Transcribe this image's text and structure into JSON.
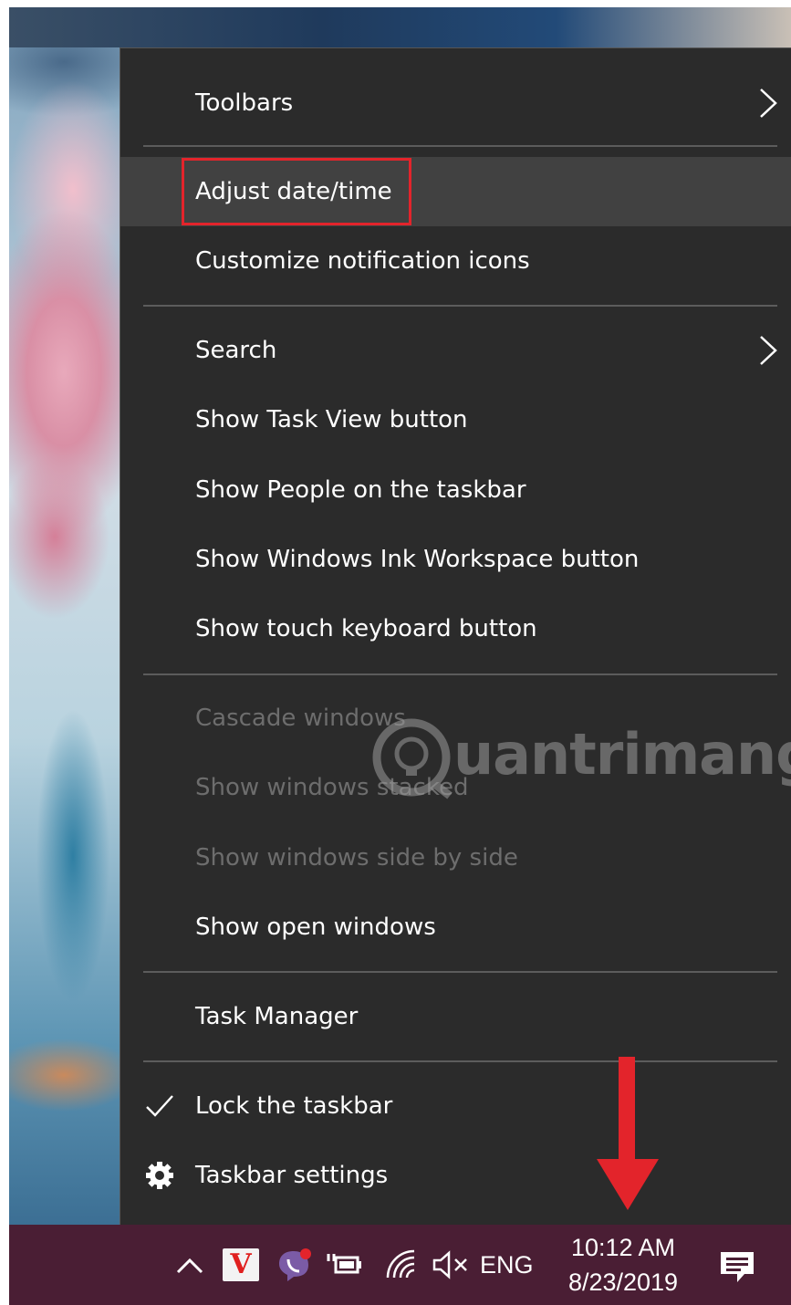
{
  "colors": {
    "menu_bg": "#2b2b2b",
    "menu_hover": "#414141",
    "separator": "#5c5c5c",
    "disabled_text": "#6d6d6d",
    "highlight_box": "#e3242b",
    "taskbar_bg": "#4a1e34",
    "annotation_arrow": "#e3242b"
  },
  "menu": {
    "toolbars": "Toolbars",
    "adjust_date_time": "Adjust date/time",
    "customize_notification_icons": "Customize notification icons",
    "search": "Search",
    "show_task_view_button": "Show Task View button",
    "show_people": "Show People on the taskbar",
    "show_ink_workspace": "Show Windows Ink Workspace button",
    "show_touch_keyboard": "Show touch keyboard button",
    "cascade_windows": "Cascade windows",
    "show_windows_stacked": "Show windows stacked",
    "show_windows_side_by_side": "Show windows side by side",
    "show_open_windows": "Show open windows",
    "task_manager": "Task Manager",
    "lock_taskbar": "Lock the taskbar",
    "taskbar_settings": "Taskbar settings",
    "lock_taskbar_checked": true
  },
  "taskbar": {
    "tray_icons": [
      "chevron-up-icon",
      "vivaldi-icon",
      "viber-icon",
      "power-icon",
      "wifi-icon",
      "volume-muted-icon",
      "notification-icon"
    ],
    "vivaldi_glyph": "V",
    "language": "ENG",
    "time": "10:12 AM",
    "date": "8/23/2019"
  },
  "watermark": {
    "text": "uantrimang"
  }
}
